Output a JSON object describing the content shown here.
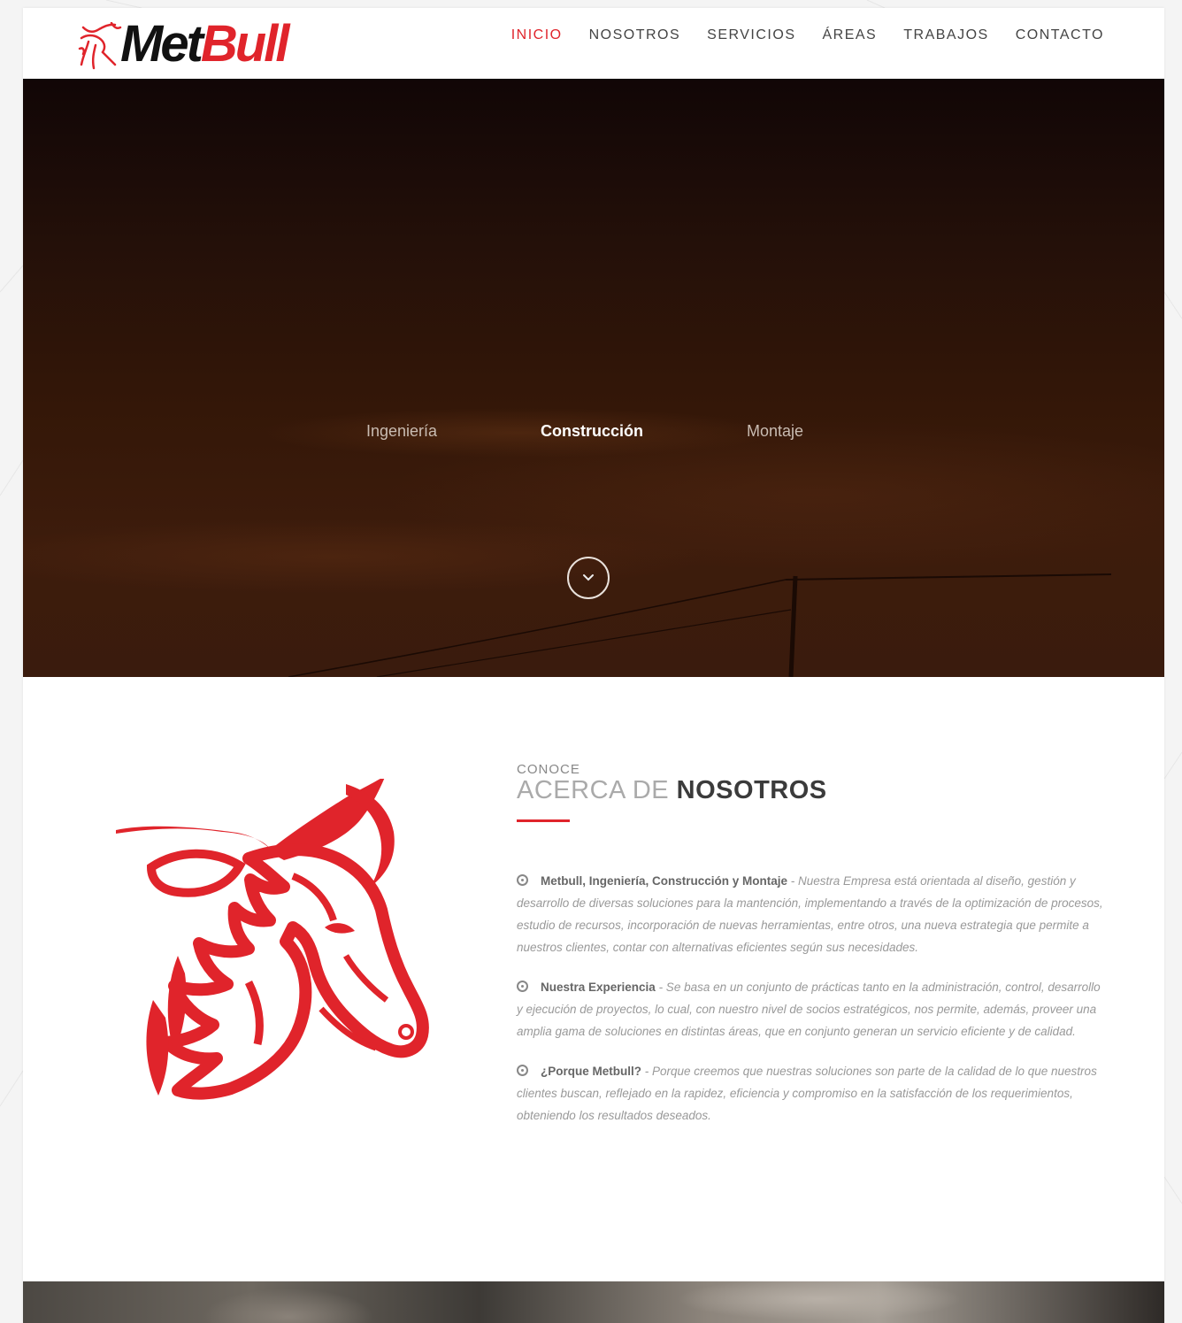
{
  "brand": {
    "name_part1": "Met",
    "name_part2": "Bull",
    "accent": "#e0242b"
  },
  "nav": {
    "items": [
      {
        "label": "INICIO",
        "active": true
      },
      {
        "label": "NOSOTROS",
        "active": false
      },
      {
        "label": "SERVICIOS",
        "active": false
      },
      {
        "label": "ÁREAS",
        "active": false
      },
      {
        "label": "TRABAJOS",
        "active": false
      },
      {
        "label": "CONTACTO",
        "active": false
      }
    ]
  },
  "hero": {
    "tabs": [
      {
        "label": "Ingeniería",
        "active": false
      },
      {
        "label": "Construcción",
        "active": true
      },
      {
        "label": "Montaje",
        "active": false
      }
    ],
    "scroll_icon": "chevron-down-icon"
  },
  "about": {
    "kicker": "CONOCE",
    "title_light": "ACERCA DE",
    "title_bold": "NOSOTROS",
    "paragraphs": [
      {
        "lead": "Metbull, Ingeniería, Construcción y Montaje",
        "text": " - Nuestra Empresa está orientada al diseño, gestión y desarrollo de diversas soluciones para la mantención, implementando a través de la optimización de procesos, estudio de recursos, incorporación de nuevas herramientas, entre otros, una nueva estrategia que permite a nuestros clientes, contar con alternativas eficientes según sus necesidades."
      },
      {
        "lead": "Nuestra Experiencia",
        "text": " - Se basa en un conjunto de prácticas tanto en la administración, control, desarrollo y ejecución de proyectos, lo cual, con nuestro nivel de socios estratégicos, nos permite, además, proveer una amplia gama de soluciones en distintas áreas, que en conjunto generan un servicio eficiente y de calidad."
      },
      {
        "lead": "¿Porque Metbull?",
        "text": " - Porque creemos que nuestras soluciones son parte de la calidad de lo que nuestros clientes buscan, reflejado en la rapidez, eficiencia y compromiso en la satisfacción de los requerimientos, obteniendo los resultados deseados."
      }
    ]
  }
}
